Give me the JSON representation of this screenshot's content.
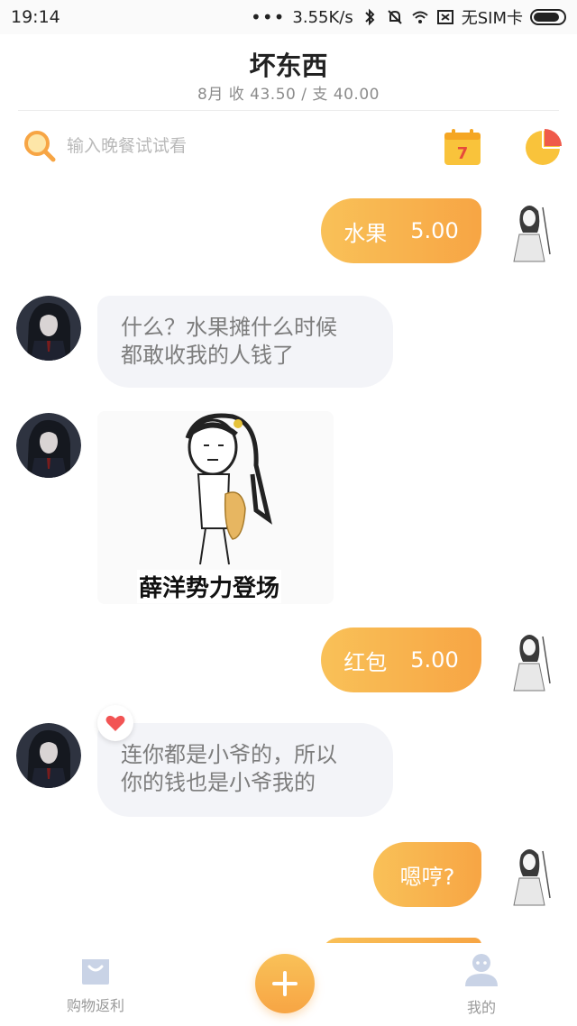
{
  "status_bar": {
    "time": "19:14",
    "dots": "•••",
    "speed": "3.55K/s",
    "sim": "无SIM卡"
  },
  "header": {
    "title": "坏东西",
    "month": "8月",
    "income_label": "收",
    "income": "43.50",
    "separator": "/",
    "expense_label": "支",
    "expense": "40.00"
  },
  "search": {
    "placeholder": "输入晚餐试试看",
    "calendar_day": "7"
  },
  "messages": [
    {
      "side": "out",
      "label": "水果",
      "amount": "5.00"
    },
    {
      "side": "in",
      "lines": [
        "什么？水果摊什么时候",
        "都敢收我的人钱了"
      ]
    },
    {
      "side": "in",
      "sticker_caption": "薛洋势力登场"
    },
    {
      "side": "out",
      "label": "红包",
      "amount": "5.00"
    },
    {
      "side": "in",
      "lines": [
        "连你都是小爷的，所以",
        "你的钱也是小爷我的"
      ],
      "liked": true
    },
    {
      "side": "out",
      "label": "嗯哼?"
    }
  ],
  "tabbar": {
    "shop_label": "购物返利",
    "mine_label": "我的"
  },
  "colors": {
    "accent": "#f7a544",
    "accent_light": "#f9c158",
    "bubble_in": "#f3f4f8",
    "heart": "#f25454"
  }
}
